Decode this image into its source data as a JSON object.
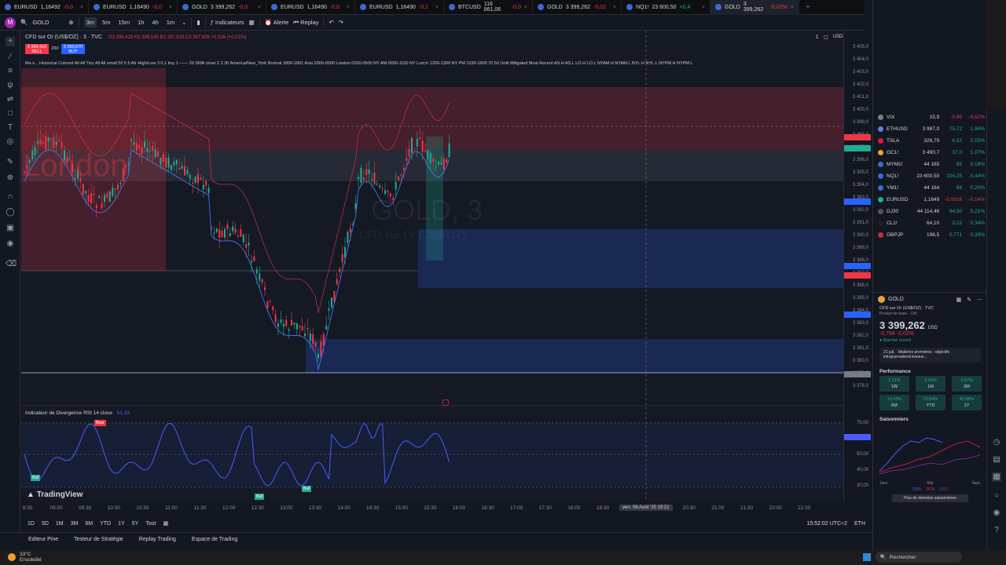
{
  "tabs": [
    {
      "symbol": "EURUSD",
      "price": "1,16492",
      "change": "-0,0"
    },
    {
      "symbol": "EURUSD",
      "price": "1,16490",
      "change": "-0,0"
    },
    {
      "symbol": "GOLD",
      "price": "3 399,262",
      "change": "-0,0"
    },
    {
      "symbol": "EURUSD",
      "price": "1,16490",
      "change": "-0,0"
    },
    {
      "symbol": "EURUSD",
      "price": "1,16490",
      "change": "-0,1"
    },
    {
      "symbol": "BTCUSD",
      "price": "116 861,06",
      "change": "-0,0"
    },
    {
      "symbol": "GOLD",
      "price": "3 399,262",
      "change": "-0,02"
    },
    {
      "symbol": "NQ1!",
      "price": "23 600,50",
      "change": "+0,4"
    },
    {
      "symbol": "GOLD",
      "price": "3 399,262",
      "change": "-0,02%"
    }
  ],
  "toolbar": {
    "avatar": "M",
    "symbol": "GOLD",
    "intervals": [
      "3m",
      "5m",
      "15m",
      "1h",
      "4h",
      "1m"
    ],
    "indicators": "Indicateurs",
    "alert": "Alerte",
    "replay": "Replay"
  },
  "chart": {
    "legend_title": "CFD sur Or (US$/OZ) · 3 · TVC",
    "legend_ohlc": "O3 398,429 H3 399,540 B3 397,919 C3 397,906 +0,336 (+0,01%)",
    "sell_price": "3 399,410",
    "sell_label": "SELL",
    "spread": "260",
    "buy_price": "3 399,670",
    "buy_label": "BUY",
    "indicator_line": "Ma s... Historical Colored All All Tiny All All small 50 5 5 Atr High/Low 3 0,1 tiny 1 —— 20 SMA close 2 3 30 America/New_York Normal 1800-1801 Asia 2000-0000 London 0200-0500 NY AM 0930-1100 NY Lunch 1200-1300 NY PM 1330-1600 70 50 Until Mitigated Most Recent AS.H AS.L LO.H LO.L NYAM.H NYAM.L NYL.H NYL.L NYPM.H NYPM.L",
    "session_label": "London",
    "watermark": "GOLD, 3",
    "watermark_sub": "CFD sur Or (US$/OZ)",
    "pane2_title": "Indicateur de Divergence RSI 14 close",
    "pane2_value": "61,38",
    "bear_label": "Bear",
    "bull_label": "Bull",
    "logo": "TradingView",
    "currency": "USD",
    "crosshair_time": "ven. 08 Août '25",
    "crosshair_hour": "19:21"
  },
  "yaxis": {
    "ticks": [
      "3 405,0",
      "3 404,0",
      "3 403,0",
      "3 402,0",
      "3 401,0",
      "3 400,0",
      "3 399,0",
      "3 398,0",
      "3 397,0",
      "3 396,0",
      "3 395,0",
      "3 394,0",
      "3 393,0",
      "3 392,0",
      "3 391,0",
      "3 390,0",
      "3 389,0",
      "3 388,0",
      "3 387,0",
      "3 386,0",
      "3 385,0",
      "3 384,0",
      "3 383,0",
      "3 382,0",
      "3 381,0",
      "3 380,0",
      "3 379,0",
      "3 378,0"
    ],
    "rsi_ticks": [
      "70,00",
      "60,00",
      "50,00",
      "40,00",
      "30,00"
    ]
  },
  "xaxis": {
    "ticks": [
      "8:30",
      "09:00",
      "09:30",
      "10:00",
      "10:30",
      "11:00",
      "11:30",
      "12:00",
      "12:30",
      "13:00",
      "13:30",
      "14:00",
      "14:30",
      "15:00",
      "15:30",
      "16:00",
      "16:30",
      "17:00",
      "17:30",
      "18:00",
      "18:30",
      "20:00",
      "20:30",
      "21:00",
      "21:30",
      "22:00",
      "22:30"
    ]
  },
  "rangebar": {
    "ranges": [
      "1D",
      "5D",
      "1M",
      "3M",
      "6M",
      "YTD",
      "1Y",
      "5Y",
      "Tout"
    ],
    "clock": "15:52:02 UTC+2",
    "session": "ETH"
  },
  "bottom": {
    "tabs": [
      "Editeur Pine",
      "Testeur de Stratégie",
      "Replay Trading",
      "Espace de Trading"
    ]
  },
  "watchlist": [
    {
      "symbol": "VIX",
      "last": "15,9",
      "chg": "-0,60",
      "pct": "-3,62%",
      "dir": "neg",
      "color": "#7b7f8a"
    },
    {
      "symbol": "ETHUSD",
      "last": "3 987,0",
      "chg": "75,72",
      "pct": "1,94%",
      "dir": "pos",
      "color": "#627eea"
    },
    {
      "symbol": "TSLA",
      "last": "328,79",
      "chg": "6,52",
      "pct": "2,02%",
      "dir": "pos",
      "color": "#e31937"
    },
    {
      "symbol": "GC1!",
      "last": "3 490,7",
      "chg": "37,0",
      "pct": "1,07%",
      "dir": "pos",
      "color": "#f0a030"
    },
    {
      "symbol": "MYM1!",
      "last": "44 165",
      "chg": "85",
      "pct": "0,19%",
      "dir": "pos",
      "color": "#3a6bd1"
    },
    {
      "symbol": "NQ1!",
      "last": "23 600,50",
      "chg": "104,25",
      "pct": "0,44%",
      "dir": "pos",
      "color": "#3a6bd1"
    },
    {
      "symbol": "YM1!",
      "last": "44 164",
      "chg": "88",
      "pct": "0,20%",
      "dir": "pos",
      "color": "#3a6bd1"
    },
    {
      "symbol": "EURUSD",
      "last": "1,1649",
      "chg": "-0,0016",
      "pct": "-0,14%",
      "dir": "neg",
      "color": "#22ab94"
    },
    {
      "symbol": "DJ30",
      "last": "44 114,46",
      "chg": "94,50",
      "pct": "0,21%",
      "dir": "pos",
      "color": "#555"
    },
    {
      "symbol": "CL1!",
      "last": "64,10",
      "chg": "0,22",
      "pct": "0,34%",
      "dir": "pos",
      "color": "#222"
    },
    {
      "symbol": "GBPJP",
      "last": "198,5",
      "chg": "0,771",
      "pct": "0,39%",
      "dir": "pos",
      "color": "#c03030"
    }
  ],
  "details": {
    "symbol": "GOLD",
    "name": "CFD sur Or (US$/OZ) · TVC",
    "type": "Produit de base · Cfd",
    "price": "3 399,262",
    "currency": "USD",
    "change": "-0,794",
    "change_pct": "-0,02%",
    "market_status": "Marché ouvert",
    "news": "21 juil. · Matières premières : objectifs intrajournaliers/niveaux...",
    "perf_title": "Performance",
    "perf": [
      {
        "v": "3,31%",
        "l": "1W"
      },
      {
        "v": "2,93%",
        "l": "1M"
      },
      {
        "v": "2,87%",
        "l": "3M"
      },
      {
        "v": "19,03%",
        "l": "6M"
      },
      {
        "v": "29,54%",
        "l": "YTD"
      },
      {
        "v": "42,08%",
        "l": "1Y"
      }
    ],
    "seasonal_title": "Saisonniers",
    "seasonal_months": [
      "Janv.",
      "Mai",
      "Sept."
    ],
    "seasonal_years": [
      "2025",
      "2024",
      "2023"
    ],
    "more_data": "Plus de données saisonnières"
  },
  "taskbar": {
    "weather_temp": "33°C",
    "weather_desc": "Ensoleillé",
    "search": "Rechercher"
  },
  "colors": {
    "bear": "#f23645",
    "bull": "#22ab94",
    "accent": "#2962ff",
    "rsi": "#4a5cff"
  }
}
